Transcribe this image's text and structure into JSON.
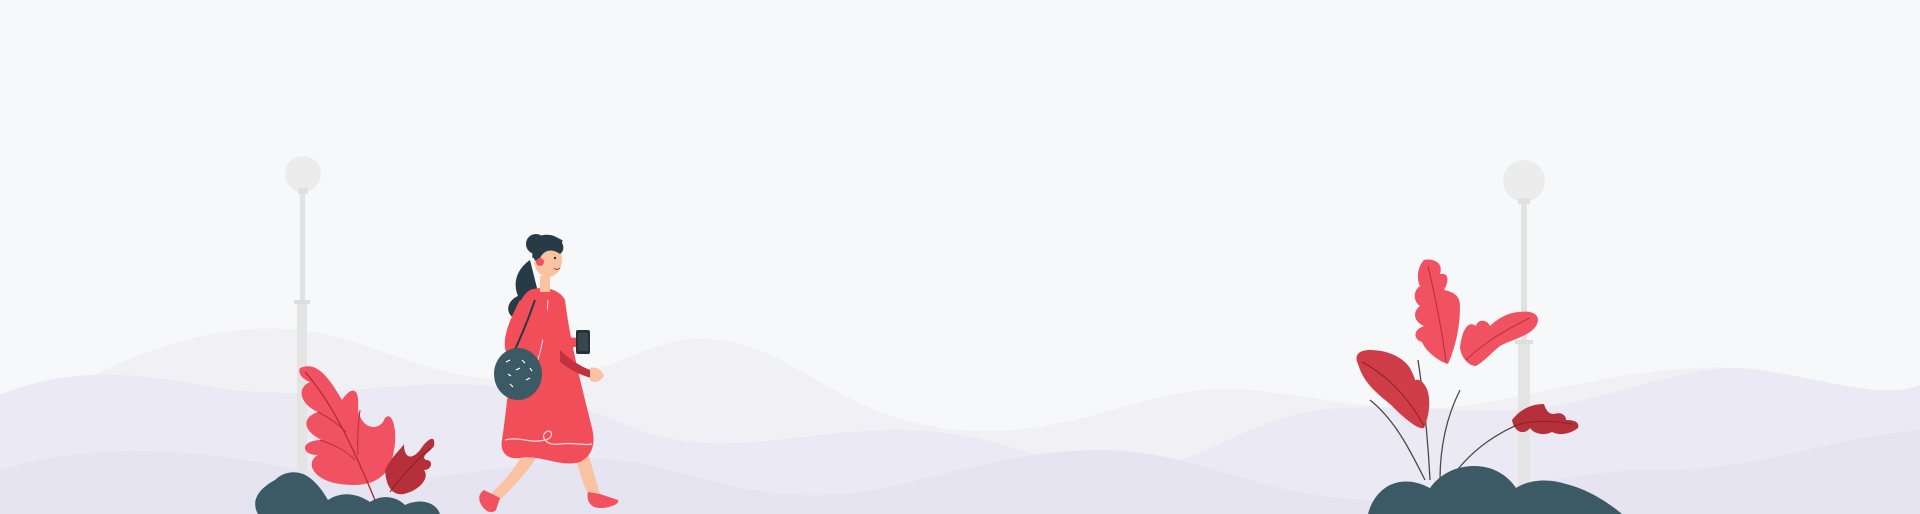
{
  "colors": {
    "sky": "#f7f8f9",
    "hill_far": "#f1f0f5",
    "hill_mid": "#ebe9f3",
    "hill_near": "#e6e4f0",
    "lamp": "#e6e6e6",
    "lamp_globe": "#ececec",
    "dress": "#f24e5a",
    "dress_dark": "#c0323d",
    "leaf_red": "#f05261",
    "leaf_dark": "#b5303a",
    "bush": "#3b5a65",
    "hair": "#263b45",
    "skin": "#f9c3a2",
    "bag": "#3b5a65",
    "phone": "#263238"
  },
  "icons": {
    "left_lamp": "street-lamp-icon",
    "right_lamp": "street-lamp-icon",
    "woman": "walking-woman-illustration",
    "left_plant": "plant-icon",
    "right_plant": "plant-icon",
    "bush": "bush-icon"
  }
}
